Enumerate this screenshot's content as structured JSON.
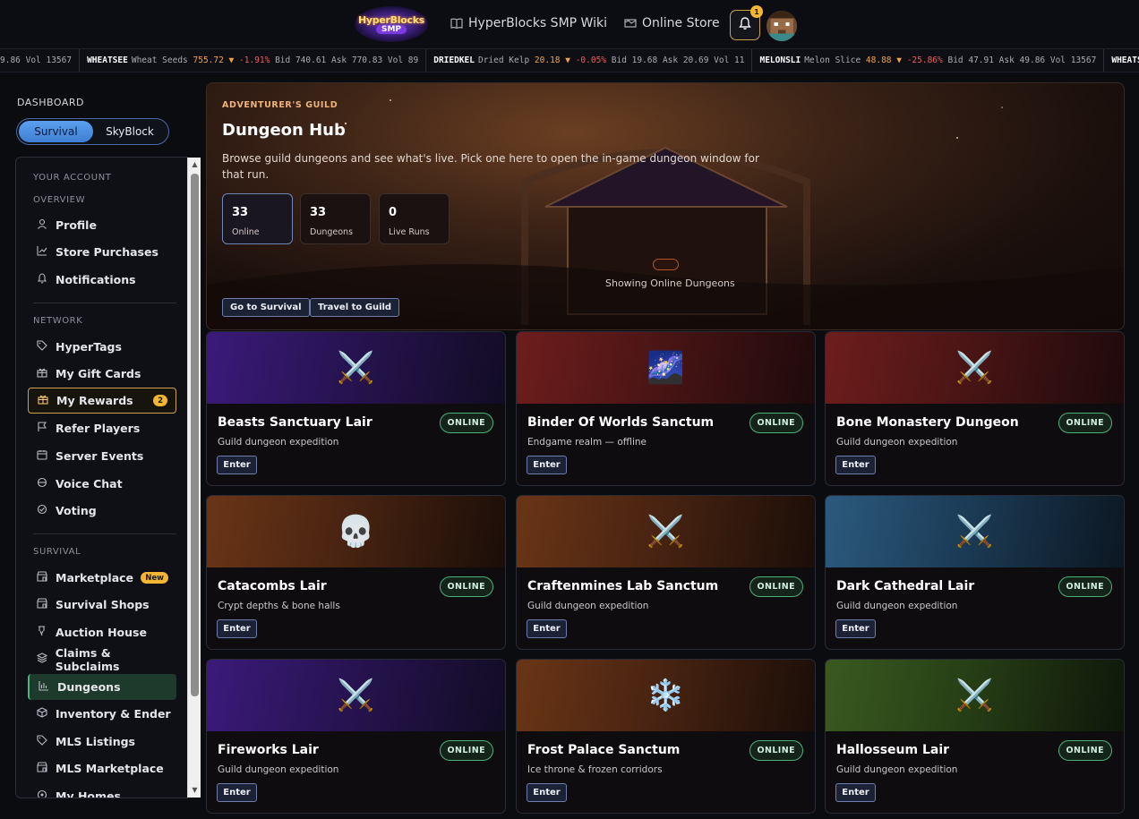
{
  "header": {
    "logo_line1": "HyperBlocks",
    "logo_line2": "SMP",
    "wiki_label": "HyperBlocks SMP Wiki",
    "store_label": "Online Store",
    "notification_count": "1"
  },
  "ticker": [
    {
      "sym": "",
      "name": "",
      "price": "",
      "change": "",
      "rest": "9.86 Vol 13567"
    },
    {
      "sym": "WHEATSEE",
      "name": "Wheat Seeds",
      "price": "755.72 ▼",
      "change": "-1.91%",
      "rest": "Bid 740.61 Ask 770.83 Vol 89"
    },
    {
      "sym": "DRIEDKEL",
      "name": "Dried Kelp",
      "price": "20.18 ▼",
      "change": "-0.05%",
      "rest": "Bid 19.68 Ask 20.69 Vol 11"
    },
    {
      "sym": "MELONSLI",
      "name": "Melon Slice",
      "price": "48.88 ▼",
      "change": "-25.86%",
      "rest": "Bid 47.91 Ask 49.86 Vol 13567"
    },
    {
      "sym": "WHEATSEE",
      "name": "",
      "price": "",
      "change": "",
      "rest": ""
    }
  ],
  "sidebar": {
    "dashboard_label": "DASHBOARD",
    "mode_active": "Survival",
    "mode_inactive": "SkyBlock",
    "sections": {
      "account": "YOUR ACCOUNT",
      "overview": "OVERVIEW",
      "network": "NETWORK",
      "survival": "SURVIVAL"
    },
    "items": {
      "profile": "Profile",
      "store_purchases": "Store Purchases",
      "notifications": "Notifications",
      "hypertags": "HyperTags",
      "gift_cards": "My Gift Cards",
      "rewards": "My Rewards",
      "rewards_badge": "2",
      "refer": "Refer Players",
      "events": "Server Events",
      "voice": "Voice Chat",
      "voting": "Voting",
      "marketplace": "Marketplace",
      "marketplace_badge": "New",
      "survival_shops": "Survival Shops",
      "auction": "Auction House",
      "claims": "Claims & Subclaims",
      "dungeons": "Dungeons",
      "inventory": "Inventory & Ender",
      "mls_listings": "MLS Listings",
      "mls_marketplace": "MLS Marketplace",
      "homes": "My Homes"
    }
  },
  "hero": {
    "tag": "ADVENTURER'S GUILD",
    "title": "Dungeon Hub",
    "description": "Browse guild dungeons and see what's live. Pick one here to open the in-game dungeon window for that run.",
    "stats": [
      {
        "value": "33",
        "label": "Online"
      },
      {
        "value": "33",
        "label": "Dungeons"
      },
      {
        "value": "0",
        "label": "Live Runs"
      }
    ],
    "btn_survival": "Go to Survival",
    "btn_guild": "Travel to Guild",
    "showing_text": "Showing Online Dungeons"
  },
  "cards": [
    {
      "title": "Beasts Sanctuary Lair",
      "subtitle": "Guild dungeon expedition",
      "status": "ONLINE",
      "icon": "⚔️",
      "icon_name": "crossed-swords-icon",
      "enter": "Enter"
    },
    {
      "title": "Binder Of Worlds Sanctum",
      "subtitle": "Endgame realm — offline",
      "status": "ONLINE",
      "icon": "🌌",
      "icon_name": "milky-way-icon",
      "enter": "Enter"
    },
    {
      "title": "Bone Monastery Dungeon",
      "subtitle": "Guild dungeon expedition",
      "status": "ONLINE",
      "icon": "⚔️",
      "icon_name": "crossed-swords-icon",
      "enter": "Enter"
    },
    {
      "title": "Catacombs Lair",
      "subtitle": "Crypt depths & bone halls",
      "status": "ONLINE",
      "icon": "💀",
      "icon_name": "skull-icon",
      "enter": "Enter"
    },
    {
      "title": "Craftenmines Lab Sanctum",
      "subtitle": "Guild dungeon expedition",
      "status": "ONLINE",
      "icon": "⚔️",
      "icon_name": "crossed-swords-icon",
      "enter": "Enter"
    },
    {
      "title": "Dark Cathedral Lair",
      "subtitle": "Guild dungeon expedition",
      "status": "ONLINE",
      "icon": "⚔️",
      "icon_name": "crossed-swords-icon",
      "enter": "Enter"
    },
    {
      "title": "Fireworks Lair",
      "subtitle": "Guild dungeon expedition",
      "status": "ONLINE",
      "icon": "⚔️",
      "icon_name": "crossed-swords-icon",
      "enter": "Enter"
    },
    {
      "title": "Frost Palace Sanctum",
      "subtitle": "Ice throne & frozen corridors",
      "status": "ONLINE",
      "icon": "❄️",
      "icon_name": "snowflake-icon",
      "enter": "Enter"
    },
    {
      "title": "Hallosseum Lair",
      "subtitle": "Guild dungeon expedition",
      "status": "ONLINE",
      "icon": "⚔️",
      "icon_name": "crossed-swords-icon",
      "enter": "Enter"
    }
  ],
  "colors": {
    "accent_blue": "#4f8fe0",
    "gold": "#f2b632",
    "online_green": "#4bb07a"
  }
}
